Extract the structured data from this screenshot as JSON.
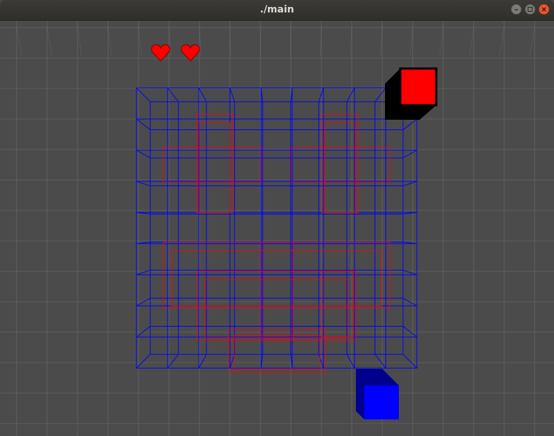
{
  "window": {
    "title": "./main"
  },
  "controls": {
    "minimize_icon": "minimize-icon",
    "maximize_icon": "maximize-icon",
    "close_icon": "close-icon"
  },
  "hud": {
    "lives": 2,
    "life_icon": "heart-icon"
  },
  "game": {
    "board_grid_columns": 9,
    "board_grid_rows": 9,
    "piece_color": "#ff0000",
    "board_color": "#0000ff",
    "floor_color": "#4b4b4b",
    "next_piece_color": "#ff0000",
    "player_cube_color": "#0000ff"
  }
}
